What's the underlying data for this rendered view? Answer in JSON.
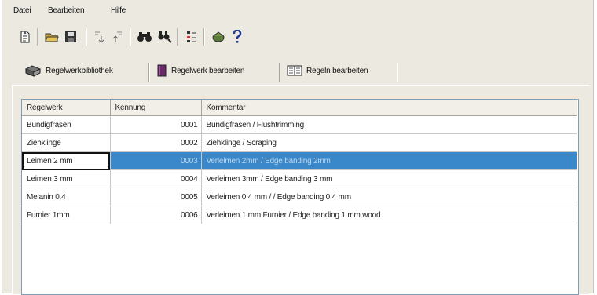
{
  "menu": {
    "file": "Datei",
    "edit": "Bearbeiten",
    "help": "Hilfe"
  },
  "toolbar": {
    "buttons": [
      "new-document-icon",
      "open-folder-icon",
      "save-disk-icon",
      "sort-icon",
      "sort-reverse-icon",
      "find-icon",
      "find-next-icon",
      "list-settings-icon",
      "tools-icon",
      "help-icon"
    ]
  },
  "tabs": [
    {
      "label": "Regelwerkbibliothek",
      "icon": "library-books-icon",
      "active": true
    },
    {
      "label": "Regelwerk bearbeiten",
      "icon": "edit-book-icon",
      "active": false
    },
    {
      "label": "Regeln bearbeiten",
      "icon": "open-book-icon",
      "active": false
    }
  ],
  "table": {
    "headers": [
      "Regelwerk",
      "Kennung",
      "Kommentar"
    ],
    "rows": [
      {
        "name": "Bündigfräsen",
        "id": "0001",
        "comment": "Bündigfräsen / Flushtrimming",
        "selected": false
      },
      {
        "name": "Ziehklinge",
        "id": "0002",
        "comment": "Ziehklinge / Scraping",
        "selected": false
      },
      {
        "name": "Leimen 2 mm",
        "id": "0003",
        "comment": "Verleimen 2mm  / Edge banding 2mm",
        "selected": true
      },
      {
        "name": "Leimen 3 mm",
        "id": "0004",
        "comment": "Verleimen 3mm  / Edge banding 3 mm",
        "selected": false
      },
      {
        "name": "Melanin 0.4",
        "id": "0005",
        "comment": "Verleimen 0.4 mm / / Edge banding 0.4 mm",
        "selected": false
      },
      {
        "name": "Furnier 1mm",
        "id": "0006",
        "comment": "Verleimen 1 mm Furnier  / Edge banding 1 mm wood",
        "selected": false
      }
    ]
  },
  "colors": {
    "selection": "#3a87c9",
    "panel": "#ece9e1",
    "grid_border": "#7f9db9"
  }
}
